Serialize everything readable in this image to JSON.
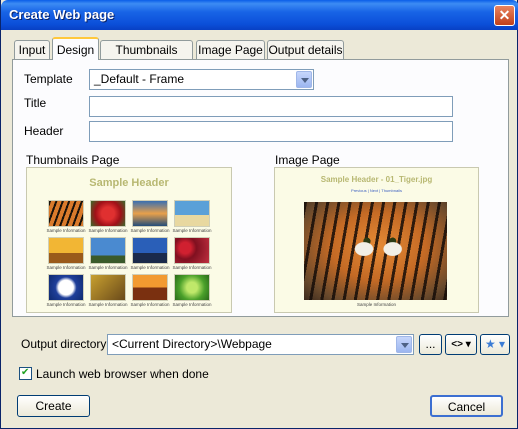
{
  "window": {
    "title": "Create Web page",
    "close": "✕"
  },
  "tabs": [
    "Input",
    "Design",
    "Thumbnails Page",
    "Image Page",
    "Output details"
  ],
  "form": {
    "template_label": "Template",
    "template_value": "_Default - Frame",
    "title_label": "Title",
    "title_value": "",
    "header_label": "Header",
    "header_value": ""
  },
  "thumbs_preview": {
    "label": "Thumbnails Page",
    "header": "Sample Header",
    "caption": "Sample Information",
    "images": [
      "tiger",
      "rose",
      "sunset-lake",
      "palm-beach",
      "desert-sun",
      "cactus-sky",
      "city-sky",
      "berries",
      "dandelion",
      "autumn-leaves",
      "canyon-sunset",
      "green-leaf"
    ]
  },
  "image_preview": {
    "label": "Image Page",
    "header": "Sample Header - 01_Tiger.jpg",
    "nav": "Previous | Next | Thumbnails",
    "caption": "Sample Information"
  },
  "output": {
    "label": "Output directory",
    "value": "<Current Directory>\\Webpage",
    "browse": "...",
    "tags_button": "<> ▾",
    "fav_button": "★ ▾"
  },
  "launch": {
    "label": "Launch web browser when done",
    "checked": true,
    "mark": "✔"
  },
  "buttons": {
    "create": "Create",
    "cancel": "Cancel"
  }
}
